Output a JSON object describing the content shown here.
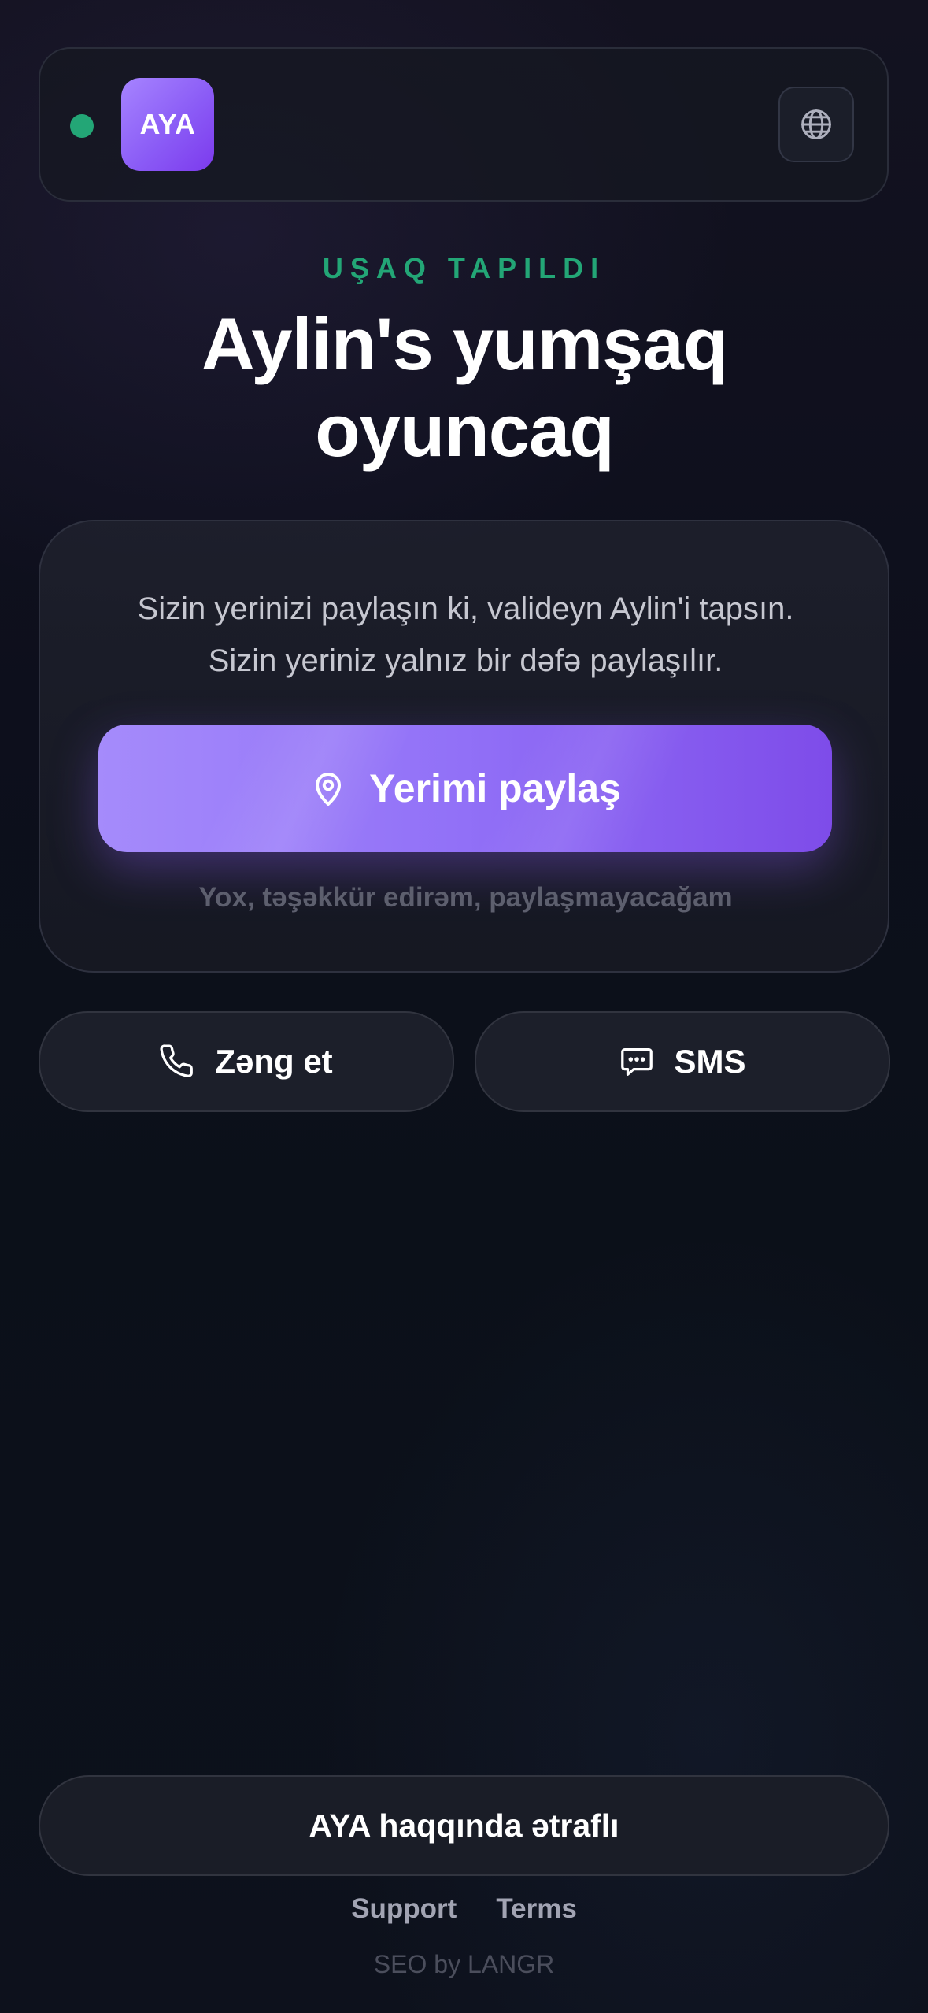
{
  "header": {
    "logo_text": "AYA",
    "status_color": "#23a676",
    "language_icon": "globe-icon"
  },
  "hero": {
    "eyebrow": "UŞAQ TAPILDI",
    "title": "Aylin's yumşaq oyuncaq"
  },
  "share_card": {
    "line1": "Sizin yerinizi paylaşın ki, valideyn Aylin'i tapsın.",
    "line2": "Sizin yeriniz yalnız bir dəfə paylaşılır.",
    "share_button_label": "Yerimi paylaş",
    "share_button_icon": "location-pin-icon",
    "decline_label": "Yox, təşəkkür edirəm, paylaşmayacağam"
  },
  "contact": {
    "call_label": "Zəng et",
    "call_icon": "phone-icon",
    "sms_label": "SMS",
    "sms_icon": "chat-bubble-icon"
  },
  "footer": {
    "about_label": "AYA haqqında ətraflı",
    "links": [
      "Support",
      "Terms"
    ],
    "credit": "SEO by LANGR"
  },
  "colors": {
    "accent": "#8b5cf6",
    "success": "#23a676",
    "background": "#0d0f1c"
  }
}
